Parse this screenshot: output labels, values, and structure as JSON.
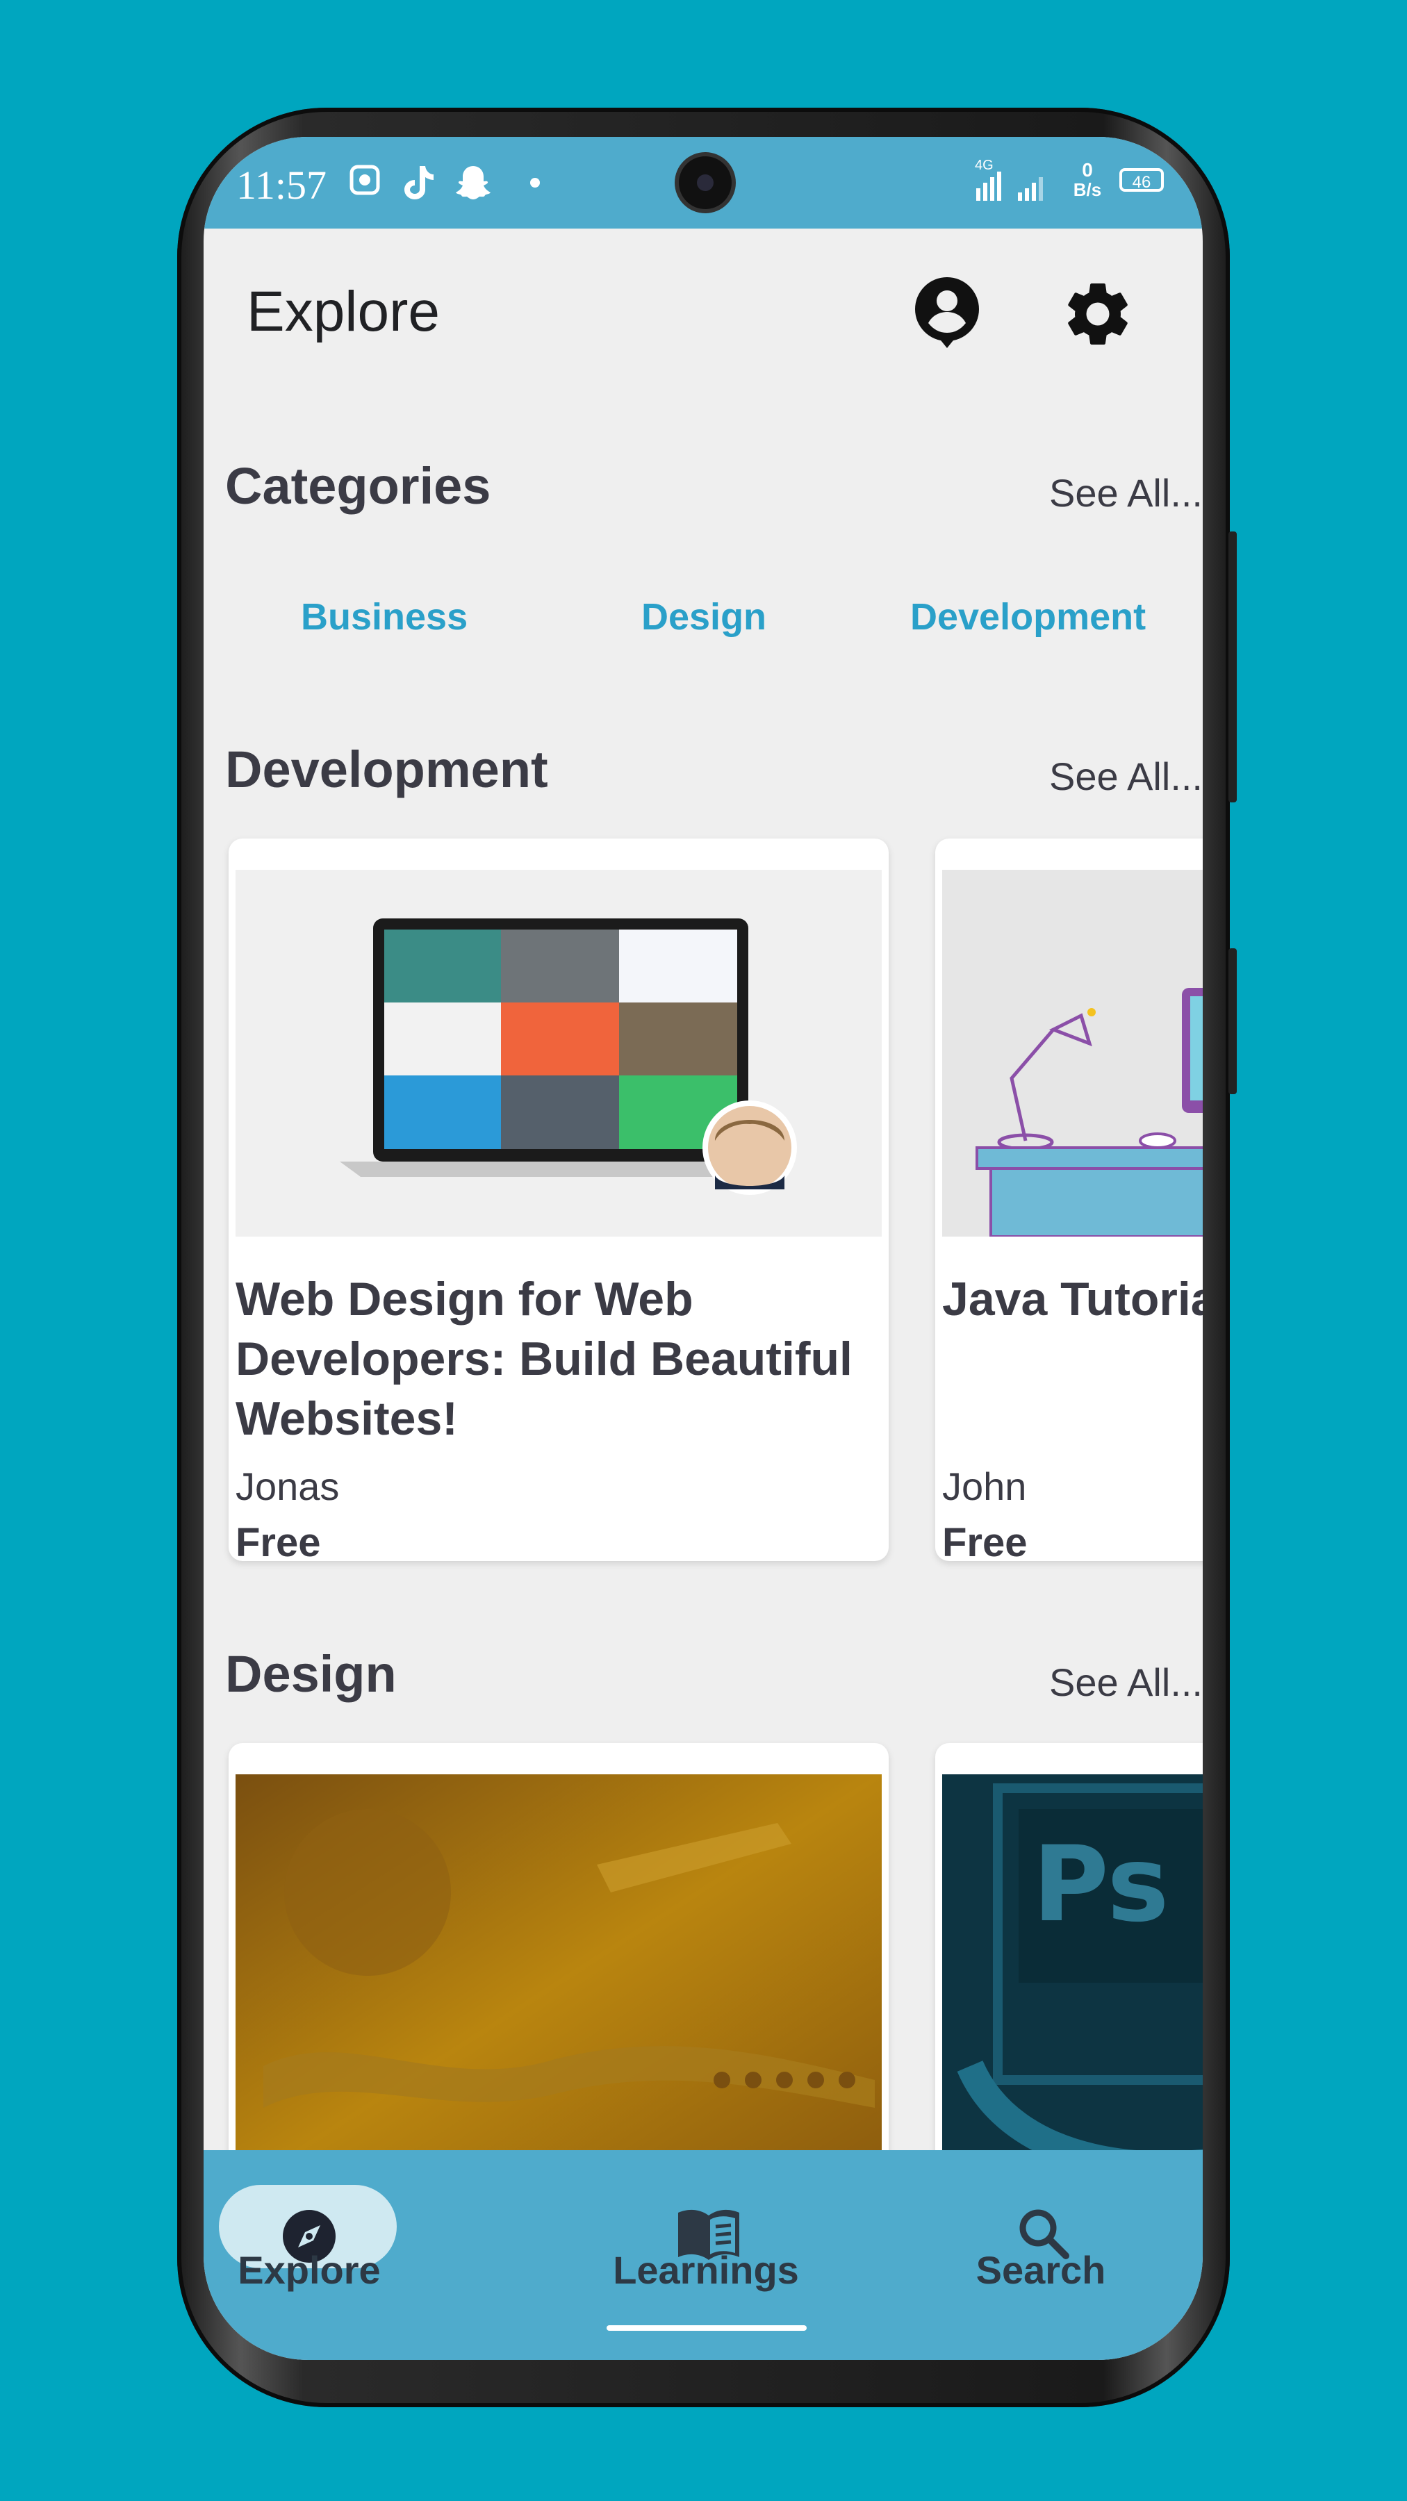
{
  "status": {
    "time": "11:57",
    "net": "4G",
    "speed_top": "0",
    "speed_unit": "B/s",
    "battery": "46"
  },
  "header": {
    "title": "Explore"
  },
  "categories": {
    "title": "Categories",
    "see_all": "See All...",
    "items": [
      "Business",
      "Design",
      "Development"
    ]
  },
  "development": {
    "title": "Development",
    "see_all": "See All...",
    "cards": [
      {
        "title": "Web Design for Web Developers: Build Beautiful Websites!",
        "author": "Jonas",
        "price": "Free"
      },
      {
        "title": "Java Tutorial for Beginners",
        "author": "John",
        "price": "Free"
      }
    ]
  },
  "design": {
    "title": "Design",
    "see_all": "See All...",
    "thumb_text": "Ps"
  },
  "nav": {
    "explore": "Explore",
    "learnings": "Learnings",
    "search": "Search"
  },
  "colors": {
    "accent": "#2aa0c9",
    "bar": "#4fabcc",
    "background": "#00a6bf"
  }
}
